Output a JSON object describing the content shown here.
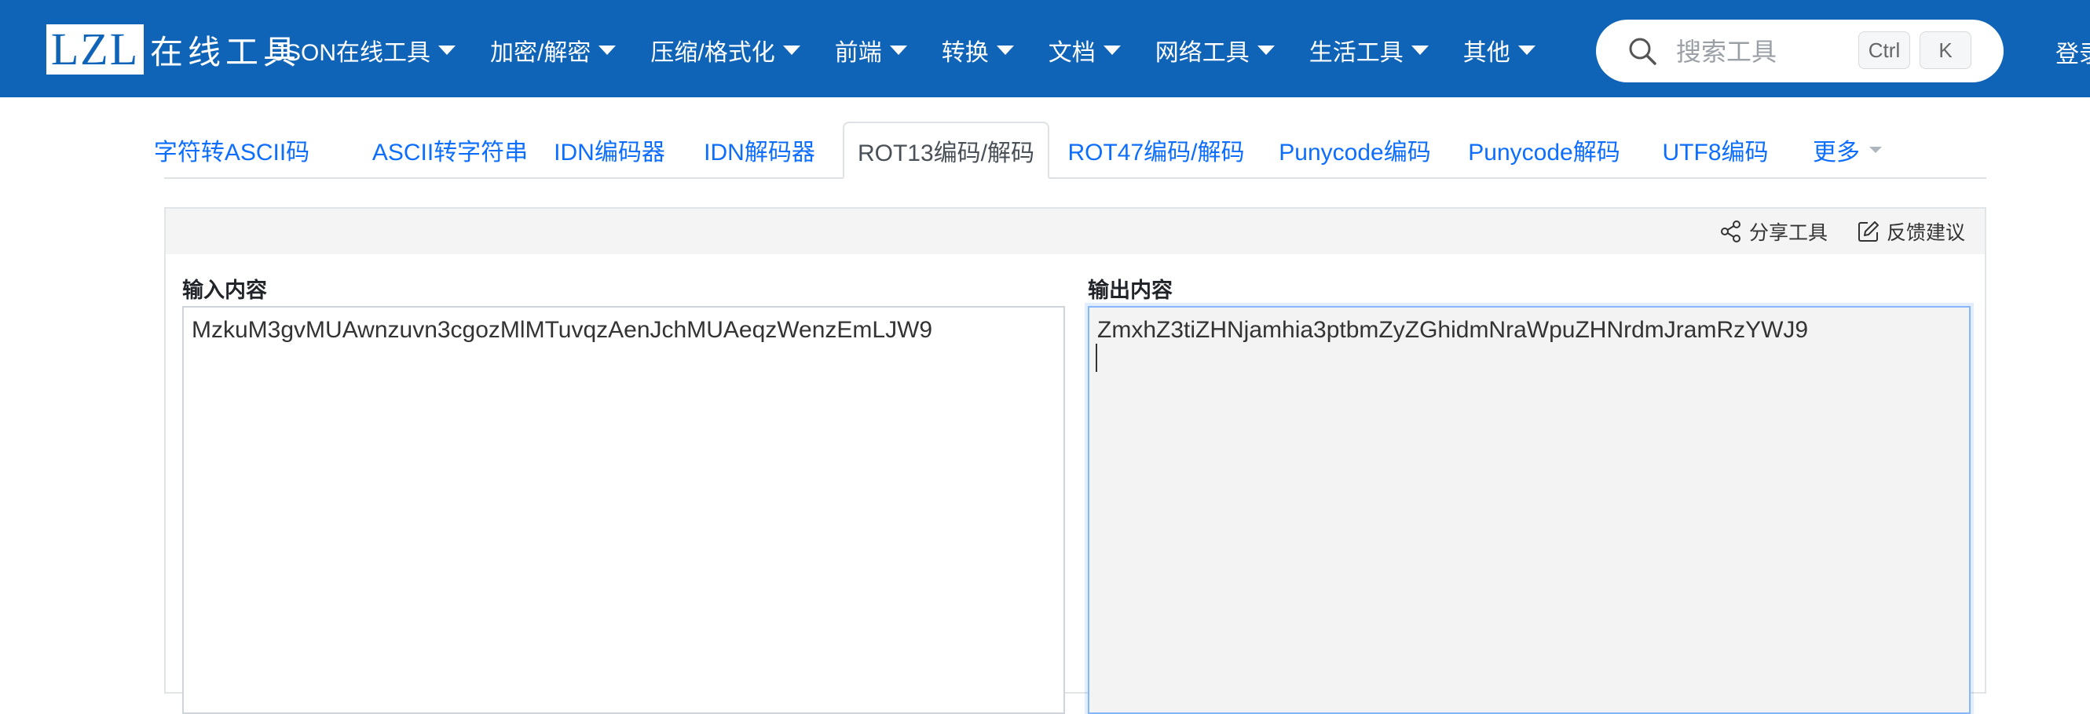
{
  "logo": {
    "abbr": "LZL",
    "text": "在线工具"
  },
  "nav": {
    "items": [
      {
        "label": "JSON在线工具"
      },
      {
        "label": "加密/解密"
      },
      {
        "label": "压缩/格式化"
      },
      {
        "label": "前端"
      },
      {
        "label": "转换"
      },
      {
        "label": "文档"
      },
      {
        "label": "网络工具"
      },
      {
        "label": "生活工具"
      },
      {
        "label": "其他"
      }
    ],
    "login": "登录"
  },
  "search": {
    "placeholder": "搜索工具",
    "shortcut_ctrl": "Ctrl",
    "shortcut_k": "K"
  },
  "tabs": [
    {
      "label": "字符转ASCII码"
    },
    {
      "label": "ASCII转字符串"
    },
    {
      "label": "IDN编码器"
    },
    {
      "label": "IDN解码器"
    },
    {
      "label": "ROT13编码/解码",
      "active": true
    },
    {
      "label": "ROT47编码/解码"
    },
    {
      "label": "Punycode编码"
    },
    {
      "label": "Punycode解码"
    },
    {
      "label": "UTF8编码"
    },
    {
      "label": "更多"
    }
  ],
  "toolbar": {
    "share": "分享工具",
    "feedback": "反馈建议"
  },
  "input": {
    "label": "输入内容",
    "value": "MzkuM3gvMUAwnzuvn3cgozMlMTuvqzAenJchMUAeqzWenzEmLJW9"
  },
  "output": {
    "label": "输出内容",
    "value": "ZmxhZ3tiZHNjamhia3ptbmZyZGhidmNraWpuZHNrdmJramRzYWJ9"
  },
  "colors": {
    "navbar": "#0f64b7",
    "link": "#0d6efd",
    "focus_border": "#86b7fe"
  }
}
